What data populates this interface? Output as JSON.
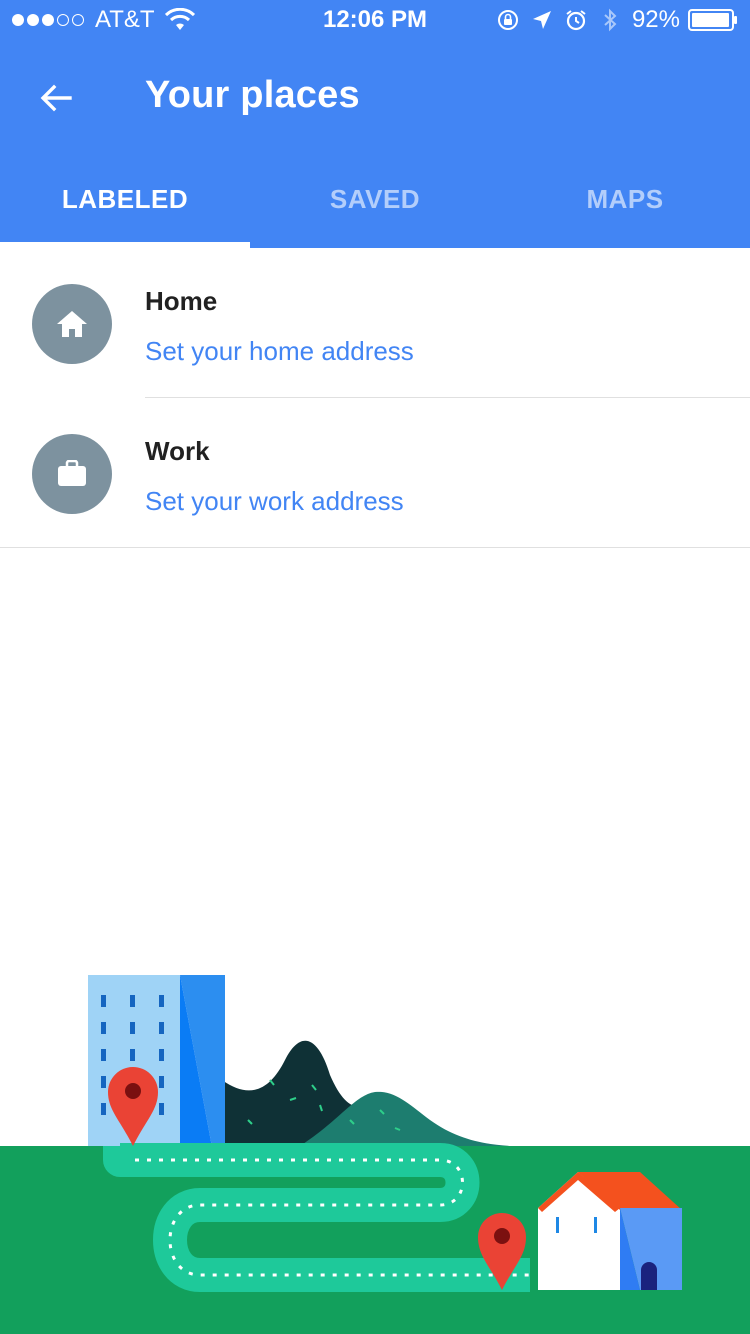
{
  "status_bar": {
    "carrier": "AT&T",
    "time": "12:06 PM",
    "battery": "92%",
    "signal_bars_filled": 3,
    "signal_bars_total": 5,
    "battery_level": 0.92,
    "icons": [
      "wifi-icon",
      "rotation-lock-icon",
      "location-arrow-icon",
      "alarm-icon",
      "bluetooth-icon",
      "battery-icon"
    ]
  },
  "header": {
    "title": "Your places",
    "back_icon": "arrow-left-icon",
    "color": "#4285f4"
  },
  "tabs": [
    {
      "label": "LABELED",
      "active": true
    },
    {
      "label": "SAVED",
      "active": false
    },
    {
      "label": "MAPS",
      "active": false
    }
  ],
  "places": [
    {
      "icon": "home-icon",
      "title": "Home",
      "subtitle": "Set your home address"
    },
    {
      "icon": "briefcase-icon",
      "title": "Work",
      "subtitle": "Set your work address"
    }
  ],
  "colors": {
    "accent": "#4285f4",
    "avatar": "#7d929f",
    "grass": "#12a05c",
    "path": "#1ec99a",
    "pin": "#ea4335"
  }
}
